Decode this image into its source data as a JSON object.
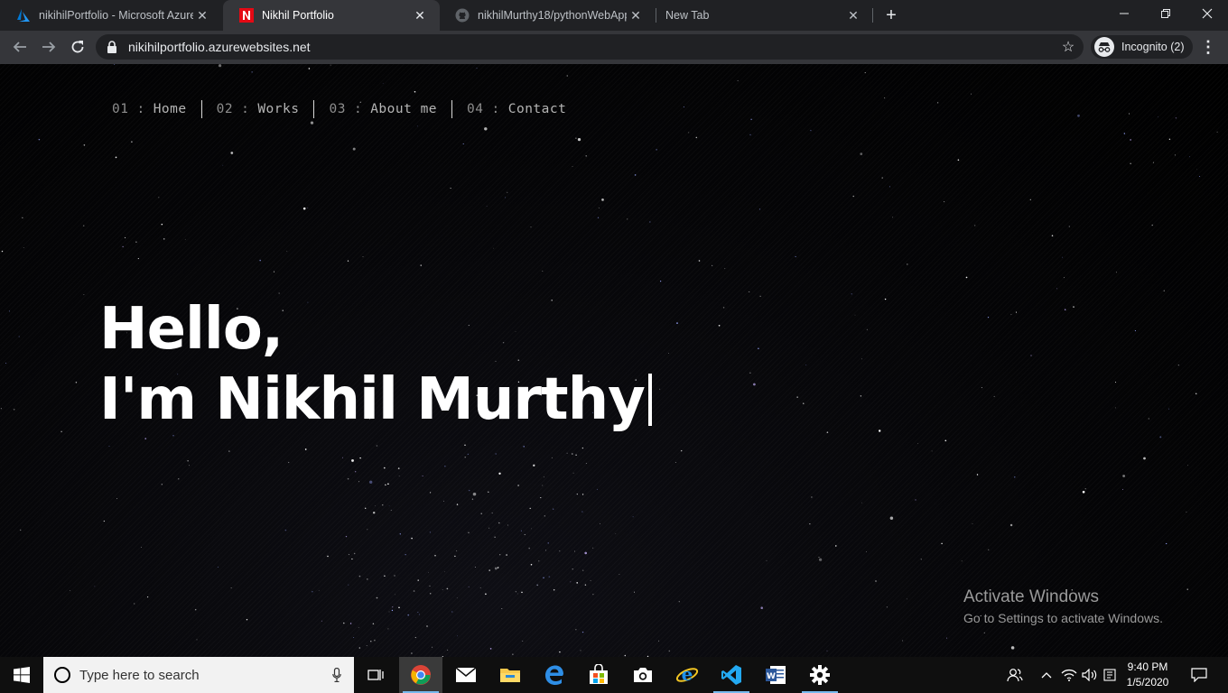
{
  "browser": {
    "tabs": [
      {
        "title": "nikihilPortfolio - Microsoft Azure",
        "icon": "azure-icon",
        "active": false
      },
      {
        "title": "Nikhil Portfolio",
        "icon": "n-logo-icon",
        "active": true
      },
      {
        "title": "nikhilMurthy18/pythonWebApp",
        "icon": "github-icon",
        "active": false
      },
      {
        "title": "New Tab",
        "icon": "",
        "active": false
      }
    ],
    "new_tab_symbol": "+",
    "window_controls": {
      "minimize": "—",
      "restore": "❐",
      "close": "✕"
    },
    "url": "nikihilportfolio.azurewebsites.net",
    "incognito_label": "Incognito (2)",
    "bookmark_symbol": "☆",
    "menu_symbol": "⋮",
    "tab_close_symbol": "✕"
  },
  "site": {
    "nav": [
      {
        "num": "01",
        "sep": ":",
        "label": "Home"
      },
      {
        "num": "02",
        "sep": ":",
        "label": "Works"
      },
      {
        "num": "03",
        "sep": ":",
        "label": "About me"
      },
      {
        "num": "04",
        "sep": ":",
        "label": "Contact"
      }
    ],
    "hero": {
      "line1": "Hello,",
      "line2": "I'm Nikhil Murthy"
    }
  },
  "watermark": {
    "title": "Activate Windows",
    "subtitle": "Go to Settings to activate Windows."
  },
  "taskbar": {
    "search_placeholder": "Type here to search",
    "apps": [
      "task-view-icon",
      "chrome-icon",
      "mail-icon",
      "file-explorer-icon",
      "edge-icon",
      "store-icon",
      "camera-icon",
      "ie-icon",
      "vscode-icon",
      "word-icon",
      "settings-icon"
    ],
    "time": "9:40 PM",
    "date": "1/5/2020"
  },
  "colors": {
    "tabstrip": "#202124",
    "toolbar": "#35363a",
    "taskbar": "#0f0f0f",
    "accent_underline": "#76b9ed",
    "azure_blue": "#0078d4",
    "n_logo_red": "#e50914"
  }
}
